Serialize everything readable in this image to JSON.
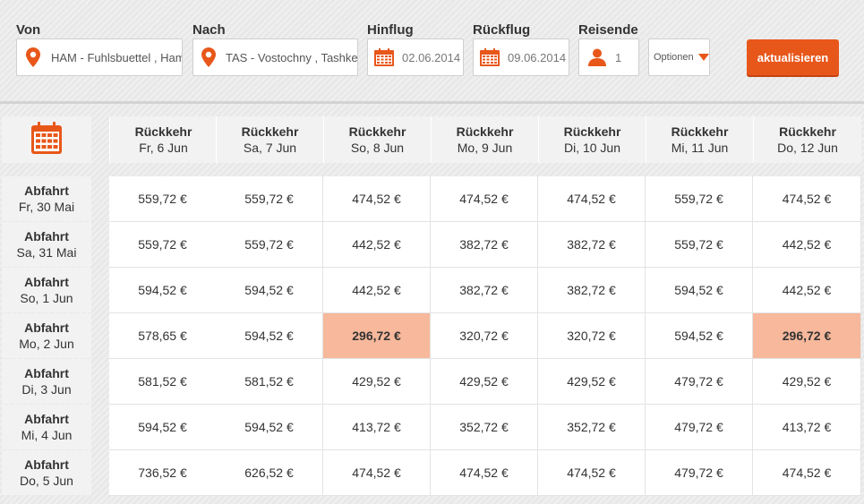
{
  "search": {
    "from_label": "Von",
    "from_value": "HAM - Fuhlsbuettel  , Ham",
    "to_label": "Nach",
    "to_value": "TAS - Vostochny  , Tashker",
    "outbound_label": "Hinflug",
    "outbound_value": "02.06.2014",
    "return_label": "Rückflug",
    "return_value": "09.06.2014",
    "travelers_label": "Reisende",
    "travelers_value": "1",
    "options_label": "Optionen",
    "update_label": "aktualisieren"
  },
  "colors": {
    "accent": "#e8571a",
    "highlight": "#f7b89b"
  },
  "grid": {
    "columns": [
      {
        "title": "Rückkehr",
        "date": "Fr, 6 Jun"
      },
      {
        "title": "Rückkehr",
        "date": "Sa, 7 Jun"
      },
      {
        "title": "Rückkehr",
        "date": "So, 8 Jun"
      },
      {
        "title": "Rückkehr",
        "date": "Mo, 9 Jun"
      },
      {
        "title": "Rückkehr",
        "date": "Di, 10 Jun"
      },
      {
        "title": "Rückkehr",
        "date": "Mi, 11 Jun"
      },
      {
        "title": "Rückkehr",
        "date": "Do, 12 Jun"
      }
    ],
    "rows": [
      {
        "title": "Abfahrt",
        "date": "Fr, 30 Mai",
        "prices": [
          "559,72 €",
          "559,72 €",
          "474,52 €",
          "474,52 €",
          "474,52 €",
          "559,72 €",
          "474,52 €"
        ],
        "cheapest": [
          false,
          false,
          false,
          false,
          false,
          false,
          false
        ]
      },
      {
        "title": "Abfahrt",
        "date": "Sa, 31 Mai",
        "prices": [
          "559,72 €",
          "559,72 €",
          "442,52 €",
          "382,72 €",
          "382,72 €",
          "559,72 €",
          "442,52 €"
        ],
        "cheapest": [
          false,
          false,
          false,
          false,
          false,
          false,
          false
        ]
      },
      {
        "title": "Abfahrt",
        "date": "So, 1 Jun",
        "prices": [
          "594,52 €",
          "594,52 €",
          "442,52 €",
          "382,72 €",
          "382,72 €",
          "594,52 €",
          "442,52 €"
        ],
        "cheapest": [
          false,
          false,
          false,
          false,
          false,
          false,
          false
        ]
      },
      {
        "title": "Abfahrt",
        "date": "Mo, 2 Jun",
        "prices": [
          "578,65 €",
          "594,52 €",
          "296,72 €",
          "320,72 €",
          "320,72 €",
          "594,52 €",
          "296,72 €"
        ],
        "cheapest": [
          false,
          false,
          true,
          false,
          false,
          false,
          true
        ]
      },
      {
        "title": "Abfahrt",
        "date": "Di, 3 Jun",
        "prices": [
          "581,52 €",
          "581,52 €",
          "429,52 €",
          "429,52 €",
          "429,52 €",
          "479,72 €",
          "429,52 €"
        ],
        "cheapest": [
          false,
          false,
          false,
          false,
          false,
          false,
          false
        ]
      },
      {
        "title": "Abfahrt",
        "date": "Mi, 4 Jun",
        "prices": [
          "594,52 €",
          "594,52 €",
          "413,72 €",
          "352,72 €",
          "352,72 €",
          "479,72 €",
          "413,72 €"
        ],
        "cheapest": [
          false,
          false,
          false,
          false,
          false,
          false,
          false
        ]
      },
      {
        "title": "Abfahrt",
        "date": "Do, 5 Jun",
        "prices": [
          "736,52 €",
          "626,52 €",
          "474,52 €",
          "474,52 €",
          "474,52 €",
          "479,72 €",
          "474,52 €"
        ],
        "cheapest": [
          false,
          false,
          false,
          false,
          false,
          false,
          false
        ]
      }
    ]
  }
}
